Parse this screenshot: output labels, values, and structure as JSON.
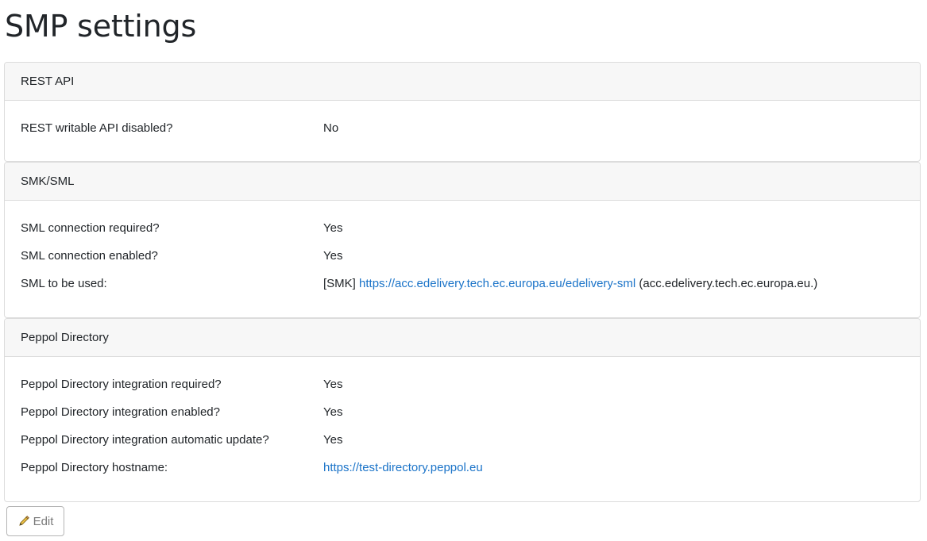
{
  "page": {
    "title": "SMP settings"
  },
  "rest_api": {
    "header": "REST API",
    "rows": [
      {
        "label": "REST writable API disabled?",
        "value": "No"
      }
    ]
  },
  "smk_sml": {
    "header": "SMK/SML",
    "rows": [
      {
        "label": "SML connection required?",
        "value": "Yes"
      },
      {
        "label": "SML connection enabled?",
        "value": "Yes"
      }
    ],
    "sml_row": {
      "label": "SML to be used:",
      "prefix": "[SMK]",
      "link": "https://acc.edelivery.tech.ec.europa.eu/edelivery-sml",
      "suffix": "(acc.edelivery.tech.ec.europa.eu.)"
    }
  },
  "peppol_directory": {
    "header": "Peppol Directory",
    "rows": [
      {
        "label": "Peppol Directory integration required?",
        "value": "Yes"
      },
      {
        "label": "Peppol Directory integration enabled?",
        "value": "Yes"
      },
      {
        "label": "Peppol Directory integration automatic update?",
        "value": "Yes"
      }
    ],
    "hostname_row": {
      "label": "Peppol Directory hostname:",
      "link": "https://test-directory.peppol.eu"
    }
  },
  "actions": {
    "edit_label": "Edit",
    "edit_icon": "pencil-icon"
  },
  "colors": {
    "link": "#1a73c8",
    "header_bg": "#f7f7f7",
    "border": "#dcdcdc"
  }
}
